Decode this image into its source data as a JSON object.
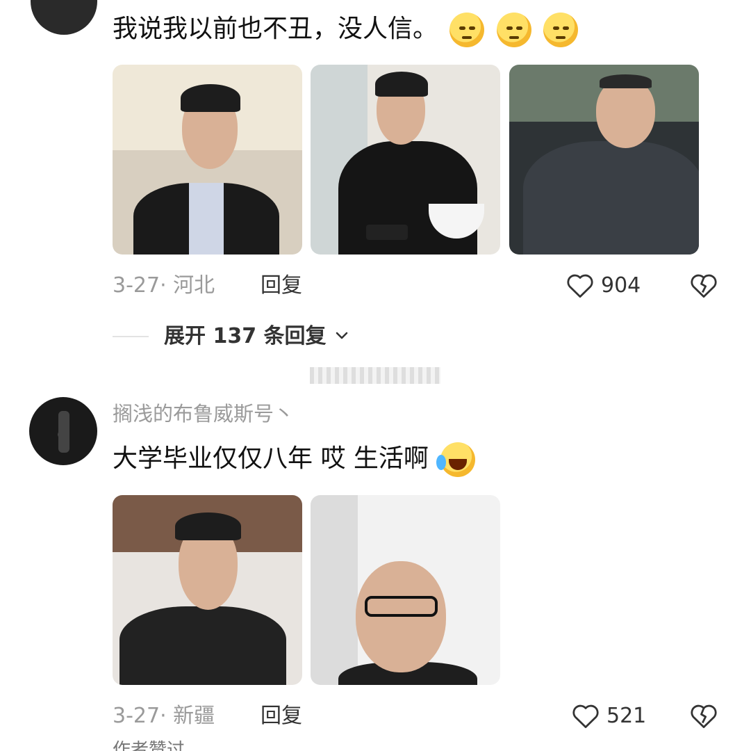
{
  "comment1": {
    "text": "我说我以前也不丑，没人信。",
    "emoji_name": "pleading-face-icon",
    "date_location": "3-27· 河北",
    "reply_label": "回复",
    "like_count": "904",
    "expand_label": "展开 137 条回复"
  },
  "comment2": {
    "username": "搁浅的布鲁威斯号丶",
    "text": "大学毕业仅仅八年 哎 生活啊",
    "emoji_name": "loudly-crying-face-icon",
    "date_location": "3-27· 新疆",
    "reply_label": "回复",
    "like_count": "521",
    "author_tag_partial": "作者赞过"
  }
}
